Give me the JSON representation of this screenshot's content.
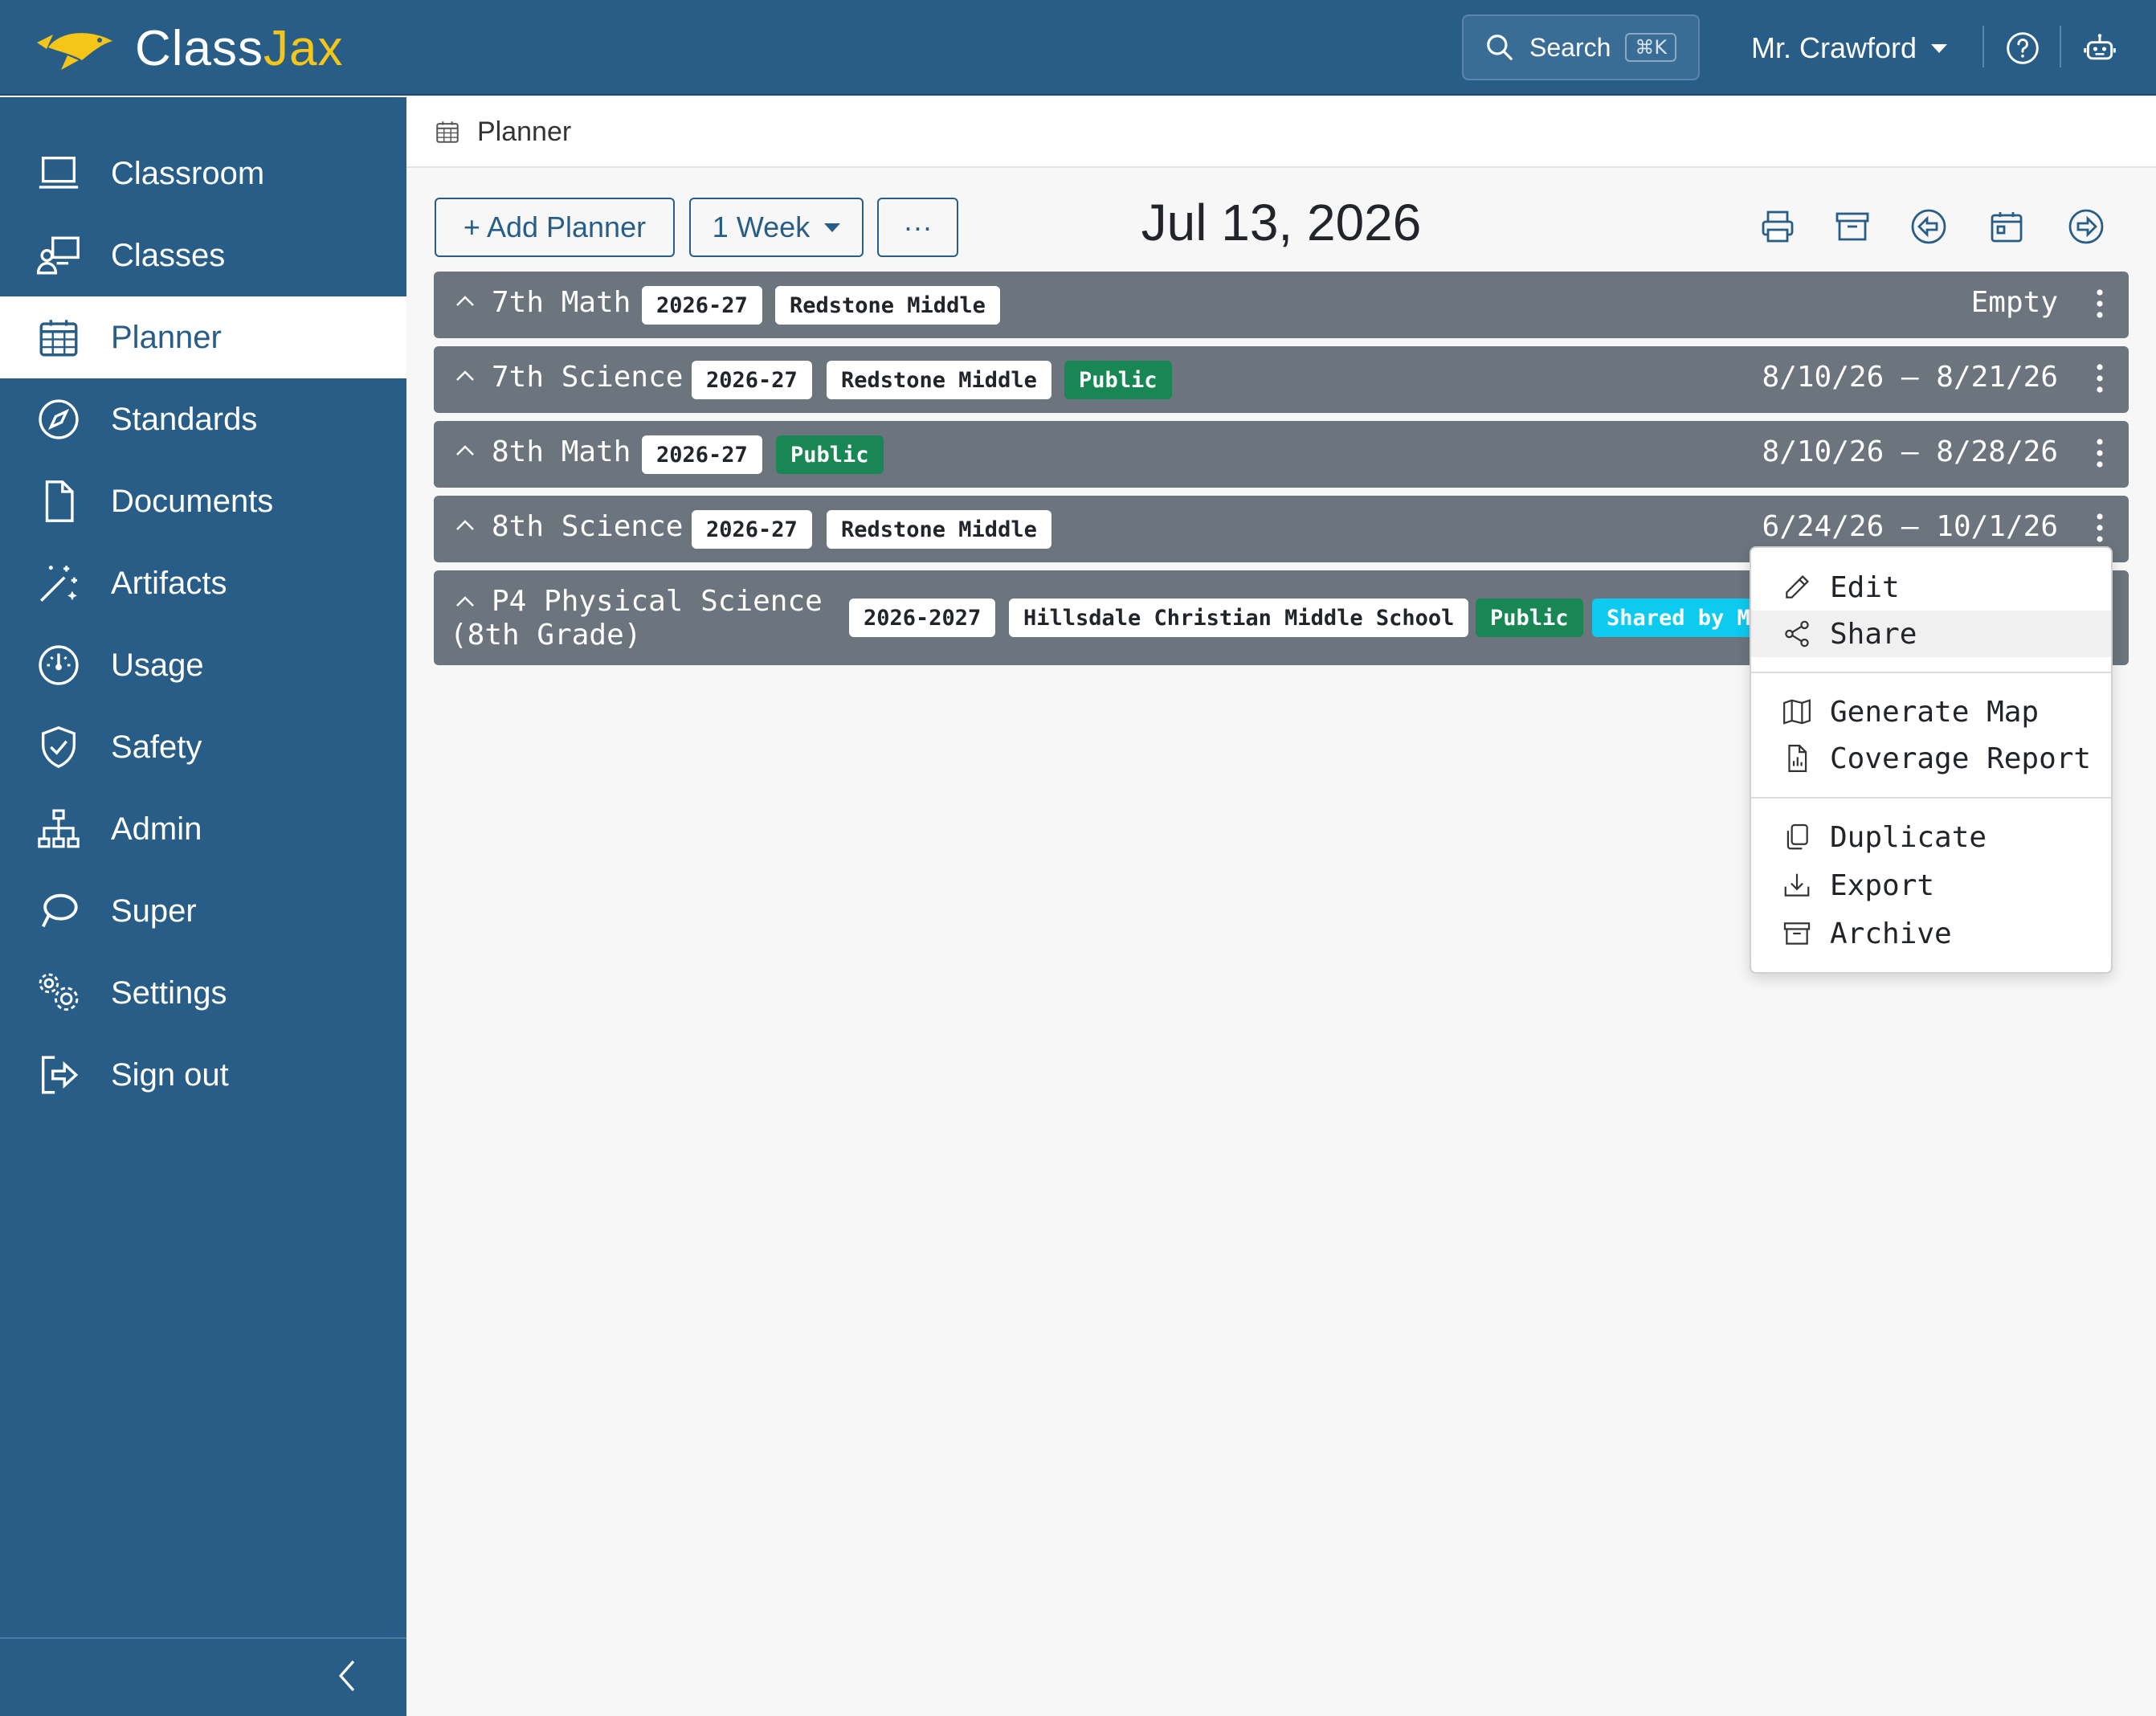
{
  "app": {
    "logo_first": "Class",
    "logo_second": "Jax"
  },
  "header": {
    "search_label": "Search",
    "search_shortcut": "⌘K",
    "user_name": "Mr. Crawford",
    "icons": [
      "help-icon",
      "robot-icon"
    ]
  },
  "sidebar": {
    "items": [
      {
        "label": "Classroom",
        "icon": "classroom-icon"
      },
      {
        "label": "Classes",
        "icon": "classes-icon"
      },
      {
        "label": "Planner",
        "icon": "calendar-icon",
        "active": true
      },
      {
        "label": "Standards",
        "icon": "compass-icon"
      },
      {
        "label": "Documents",
        "icon": "document-icon"
      },
      {
        "label": "Artifacts",
        "icon": "magic-wand-icon"
      },
      {
        "label": "Usage",
        "icon": "speedometer-icon"
      },
      {
        "label": "Safety",
        "icon": "shield-icon"
      },
      {
        "label": "Admin",
        "icon": "org-chart-icon"
      },
      {
        "label": "Super",
        "icon": "lasso-icon"
      },
      {
        "label": "Settings",
        "icon": "gears-icon"
      },
      {
        "label": "Sign out",
        "icon": "sign-out-icon"
      }
    ]
  },
  "breadcrumb": {
    "label": "Planner"
  },
  "toolbar": {
    "add_planner": "+ Add Planner",
    "range": "1 Week",
    "more": "···",
    "date": "Jul 13, 2026",
    "icons": [
      "print-icon",
      "archive-icon",
      "previous-icon",
      "calendar-today-icon",
      "next-icon"
    ]
  },
  "planners": [
    {
      "title": "7th Math",
      "badges": [
        {
          "text": "2026-27",
          "style": "light"
        },
        {
          "text": "Redstone Middle",
          "style": "light"
        }
      ],
      "range": "Empty"
    },
    {
      "title": "7th Science",
      "badges": [
        {
          "text": "2026-27",
          "style": "light"
        },
        {
          "text": "Redstone Middle",
          "style": "light"
        },
        {
          "text": "Public",
          "style": "green"
        }
      ],
      "range": "8/10/26 – 8/21/26"
    },
    {
      "title": "8th Math",
      "badges": [
        {
          "text": "2026-27",
          "style": "light"
        },
        {
          "text": "Public",
          "style": "green"
        }
      ],
      "range": "8/10/26 – 8/28/26"
    },
    {
      "title": "8th Science",
      "badges": [
        {
          "text": "2026-27",
          "style": "light"
        },
        {
          "text": "Redstone Middle",
          "style": "light"
        }
      ],
      "range": "6/24/26 – 10/1/26"
    },
    {
      "title_line1": "P4 Physical Science",
      "title_line2": "(8th Grade)",
      "badges": [
        {
          "text": "2026-2027",
          "style": "light"
        },
        {
          "text": "Hillsdale Christian Middle School",
          "style": "light"
        },
        {
          "text": "Public",
          "style": "green"
        },
        {
          "text": "Shared by M",
          "style": "cyan"
        }
      ]
    }
  ],
  "context_menu": {
    "items": [
      {
        "label": "Edit",
        "icon": "pencil-icon"
      },
      {
        "label": "Share",
        "icon": "share-icon"
      },
      {
        "label": "Generate Map",
        "icon": "map-icon"
      },
      {
        "label": "Coverage Report",
        "icon": "report-icon"
      },
      {
        "label": "Duplicate",
        "icon": "duplicate-icon"
      },
      {
        "label": "Export",
        "icon": "export-icon"
      },
      {
        "label": "Archive",
        "icon": "archive-icon"
      }
    ]
  },
  "colors": {
    "primary": "#275d87",
    "row_bg": "#6c757d",
    "badge_green": "#198754",
    "badge_cyan": "#0dcaf0",
    "logo_accent": "#f5c518"
  }
}
